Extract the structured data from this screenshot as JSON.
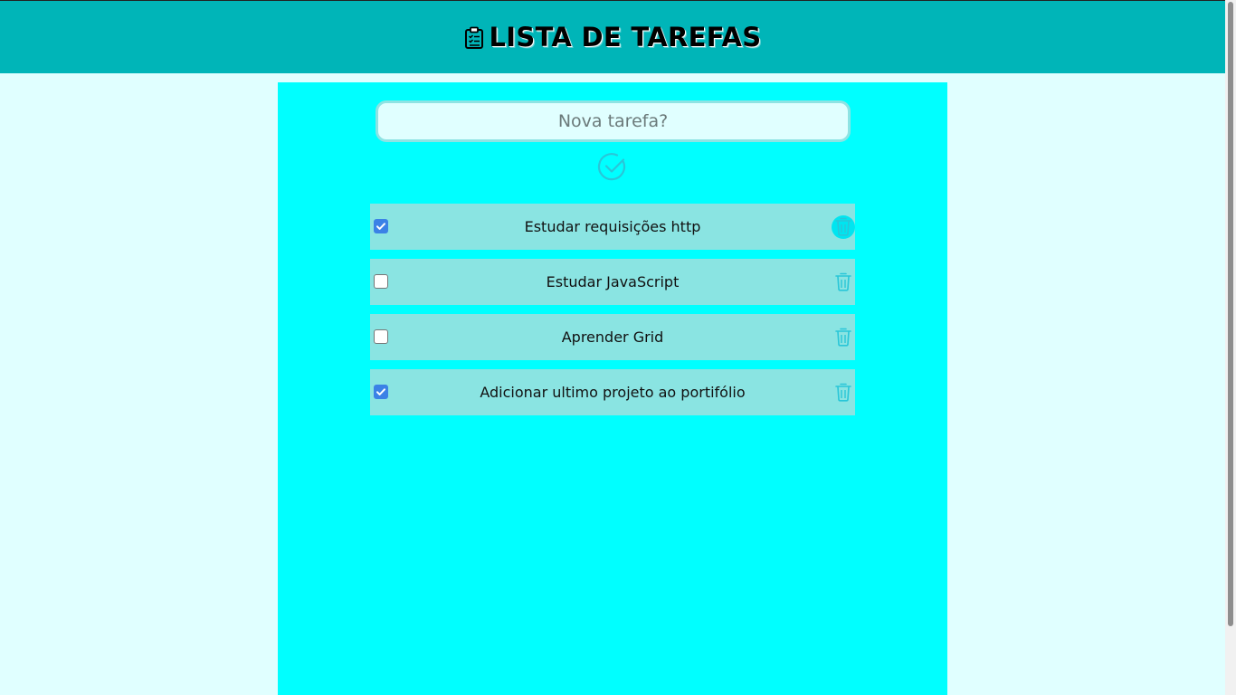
{
  "header": {
    "title": "LISTA DE TAREFAS",
    "icon": "clipboard-icon"
  },
  "form": {
    "placeholder": "Nova tarefa?",
    "value": "",
    "submit_icon": "check-circle-icon"
  },
  "tasks": [
    {
      "text": "Estudar requisições http",
      "done": true
    },
    {
      "text": "Estudar JavaScript",
      "done": false
    },
    {
      "text": "Aprender Grid",
      "done": false
    },
    {
      "text": "Adicionar ultimo projeto ao portifólio",
      "done": true
    }
  ],
  "colors": {
    "header": "#00b5b8",
    "page_background": "#e0ffff",
    "container": "#00ffff",
    "task_item": "#8ae4e2",
    "accent_icon": "#29c6d8",
    "checkbox_checked": "#3b82e6"
  }
}
